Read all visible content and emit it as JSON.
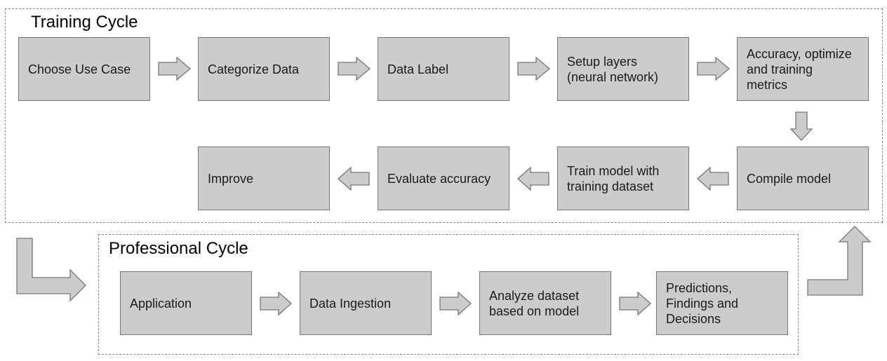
{
  "training_cycle": {
    "title": "Training Cycle",
    "steps": [
      "Choose Use Case",
      "Categorize Data",
      "Data Label",
      "Setup layers\n(neural network)",
      "Accuracy, optimize\nand training\nmetrics",
      "Compile model",
      "Train model with\ntraining dataset",
      "Evaluate accuracy",
      "Improve"
    ]
  },
  "professional_cycle": {
    "title": "Professional Cycle",
    "steps": [
      "Application",
      "Data Ingestion",
      "Analyze dataset\nbased on model",
      "Predictions,\nFindings and\nDecisions"
    ]
  },
  "colors": {
    "box_fill": "#cccccc",
    "box_border": "#777777",
    "group_border": "#8a8a8a"
  }
}
